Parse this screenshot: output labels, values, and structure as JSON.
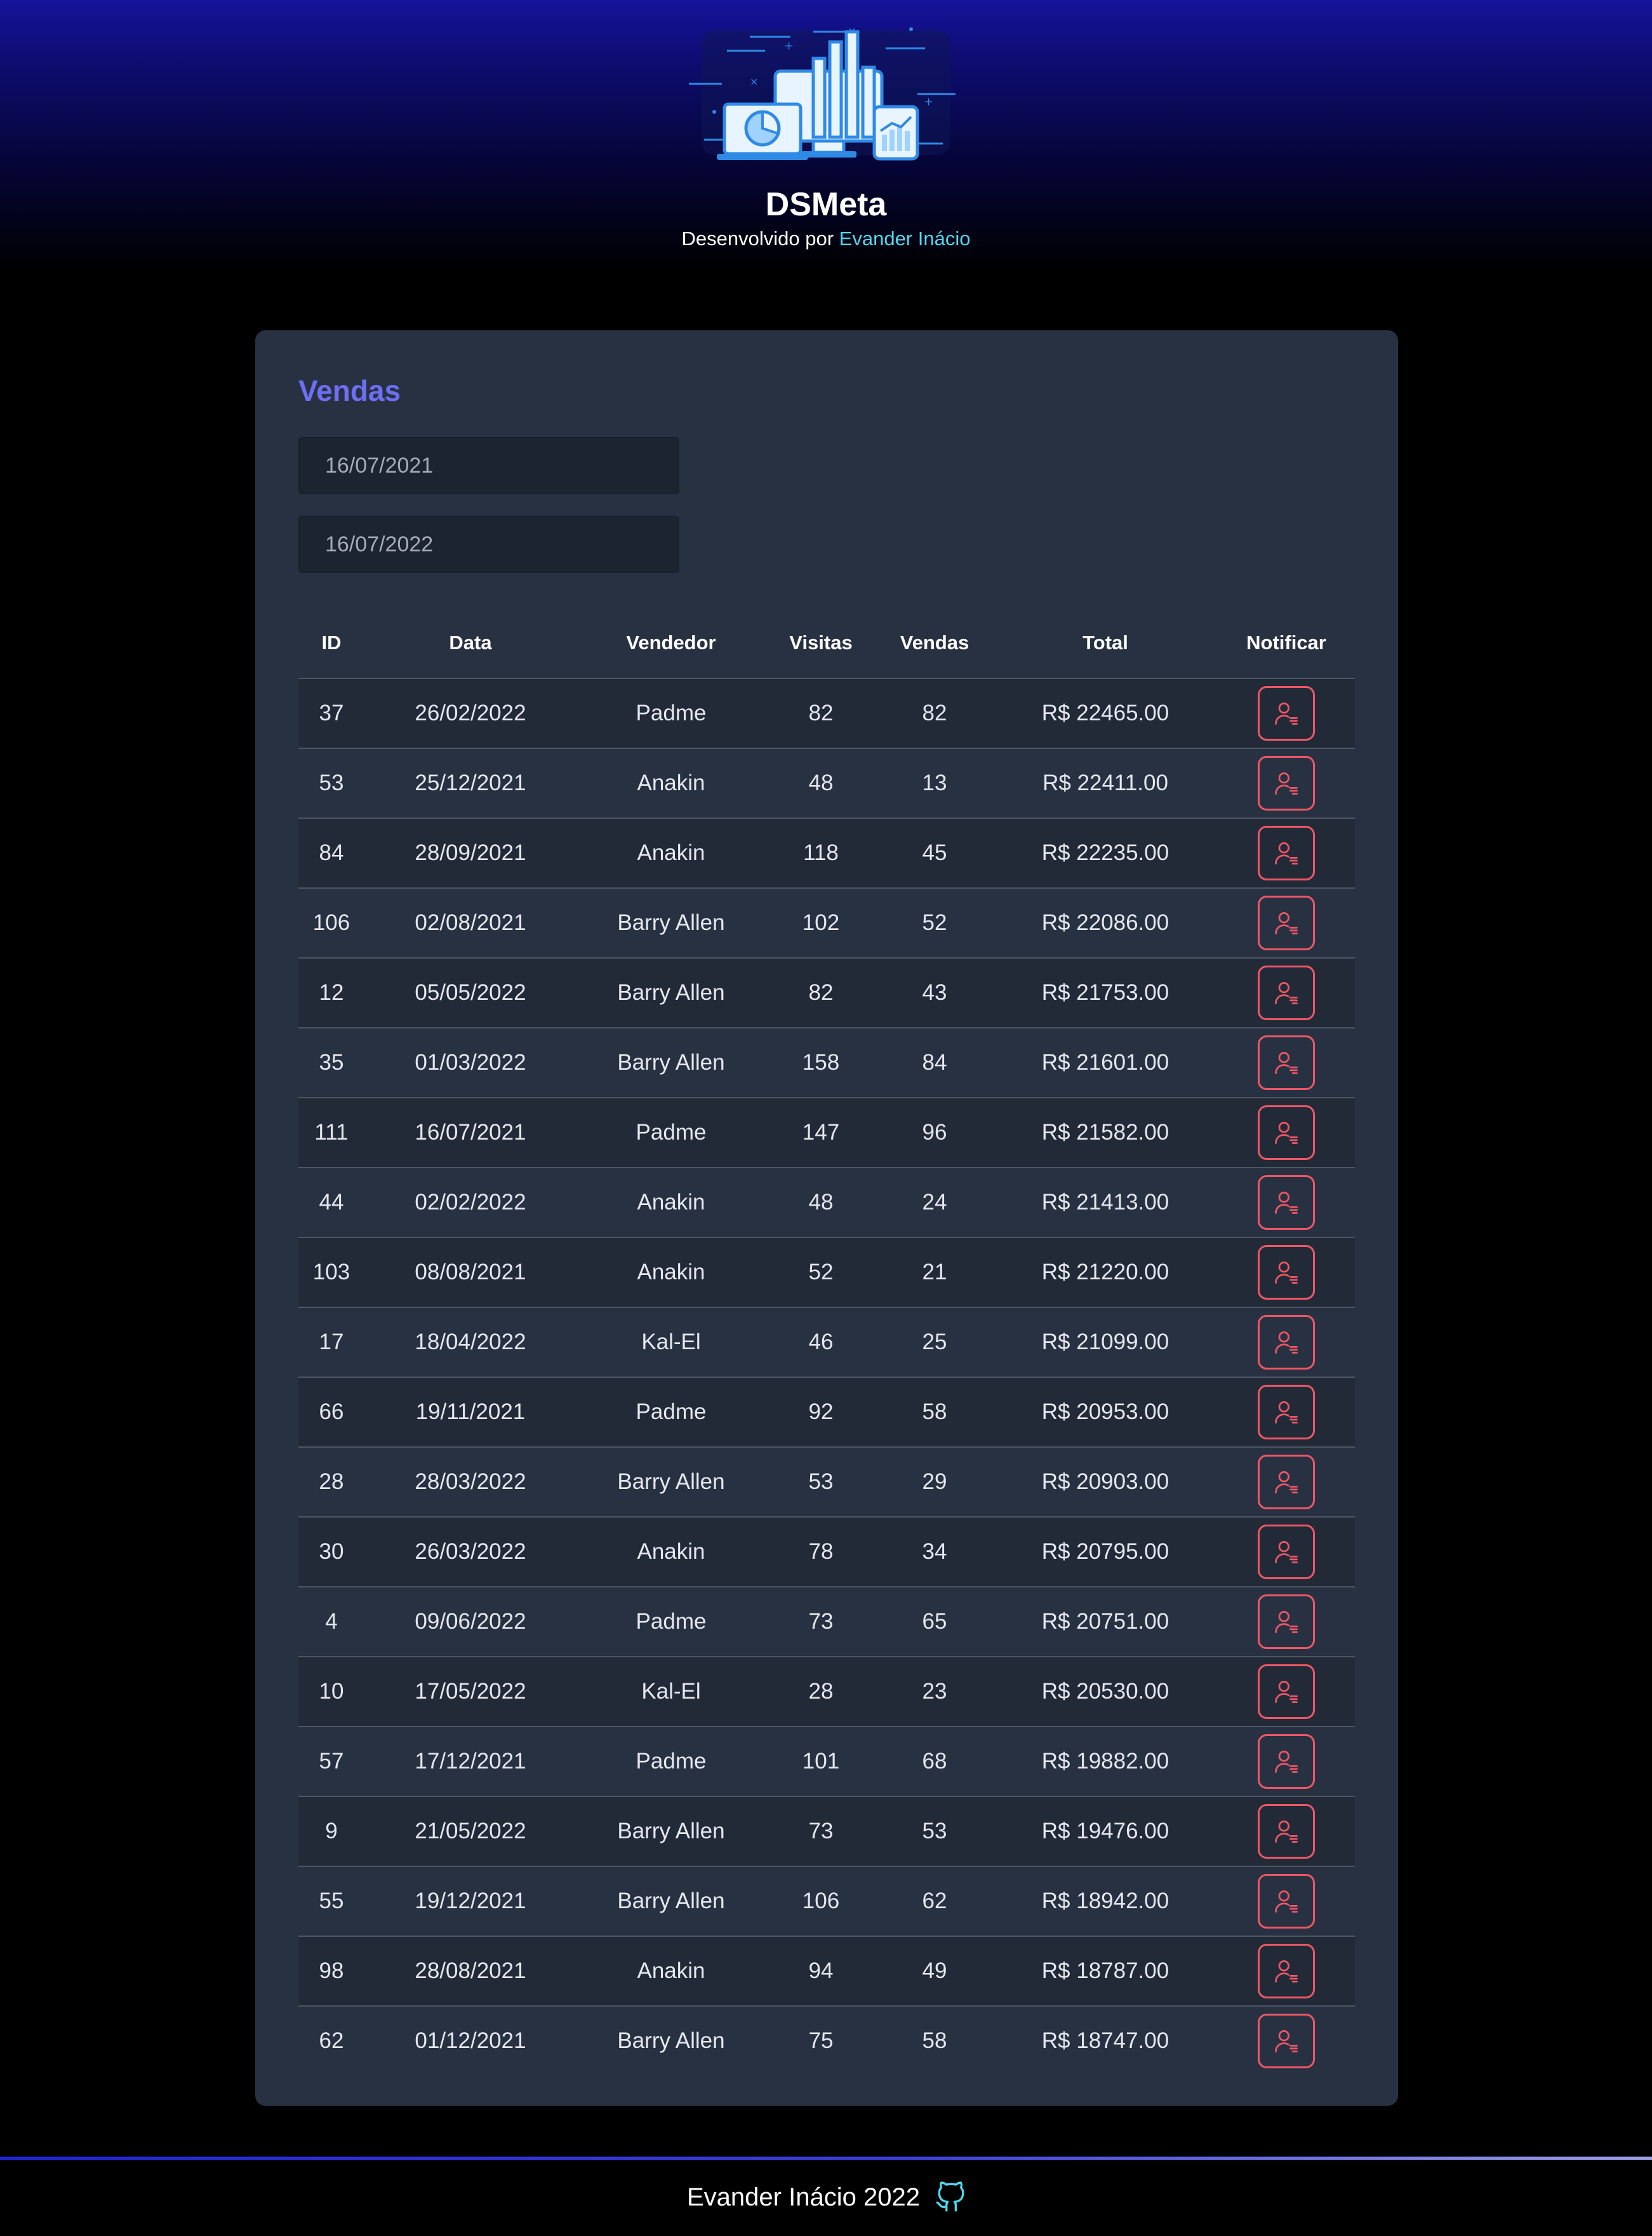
{
  "header": {
    "app_title": "DSMeta",
    "subtitle_prefix": "Desenvolvido por",
    "author_name": "Evander Inácio"
  },
  "sales": {
    "title": "Vendas",
    "date_start": "16/07/2021",
    "date_end": "16/07/2022",
    "columns": [
      "ID",
      "Data",
      "Vendedor",
      "Visitas",
      "Vendas",
      "Total",
      "Notificar"
    ],
    "rows": [
      {
        "id": "37",
        "date": "26/02/2022",
        "seller": "Padme",
        "visits": "82",
        "deals": "82",
        "total": "R$ 22465.00"
      },
      {
        "id": "53",
        "date": "25/12/2021",
        "seller": "Anakin",
        "visits": "48",
        "deals": "13",
        "total": "R$ 22411.00"
      },
      {
        "id": "84",
        "date": "28/09/2021",
        "seller": "Anakin",
        "visits": "118",
        "deals": "45",
        "total": "R$ 22235.00"
      },
      {
        "id": "106",
        "date": "02/08/2021",
        "seller": "Barry Allen",
        "visits": "102",
        "deals": "52",
        "total": "R$ 22086.00"
      },
      {
        "id": "12",
        "date": "05/05/2022",
        "seller": "Barry Allen",
        "visits": "82",
        "deals": "43",
        "total": "R$ 21753.00"
      },
      {
        "id": "35",
        "date": "01/03/2022",
        "seller": "Barry Allen",
        "visits": "158",
        "deals": "84",
        "total": "R$ 21601.00"
      },
      {
        "id": "111",
        "date": "16/07/2021",
        "seller": "Padme",
        "visits": "147",
        "deals": "96",
        "total": "R$ 21582.00"
      },
      {
        "id": "44",
        "date": "02/02/2022",
        "seller": "Anakin",
        "visits": "48",
        "deals": "24",
        "total": "R$ 21413.00"
      },
      {
        "id": "103",
        "date": "08/08/2021",
        "seller": "Anakin",
        "visits": "52",
        "deals": "21",
        "total": "R$ 21220.00"
      },
      {
        "id": "17",
        "date": "18/04/2022",
        "seller": "Kal-El",
        "visits": "46",
        "deals": "25",
        "total": "R$ 21099.00"
      },
      {
        "id": "66",
        "date": "19/11/2021",
        "seller": "Padme",
        "visits": "92",
        "deals": "58",
        "total": "R$ 20953.00"
      },
      {
        "id": "28",
        "date": "28/03/2022",
        "seller": "Barry Allen",
        "visits": "53",
        "deals": "29",
        "total": "R$ 20903.00"
      },
      {
        "id": "30",
        "date": "26/03/2022",
        "seller": "Anakin",
        "visits": "78",
        "deals": "34",
        "total": "R$ 20795.00"
      },
      {
        "id": "4",
        "date": "09/06/2022",
        "seller": "Padme",
        "visits": "73",
        "deals": "65",
        "total": "R$ 20751.00"
      },
      {
        "id": "10",
        "date": "17/05/2022",
        "seller": "Kal-El",
        "visits": "28",
        "deals": "23",
        "total": "R$ 20530.00"
      },
      {
        "id": "57",
        "date": "17/12/2021",
        "seller": "Padme",
        "visits": "101",
        "deals": "68",
        "total": "R$ 19882.00"
      },
      {
        "id": "9",
        "date": "21/05/2022",
        "seller": "Barry Allen",
        "visits": "73",
        "deals": "53",
        "total": "R$ 19476.00"
      },
      {
        "id": "55",
        "date": "19/12/2021",
        "seller": "Barry Allen",
        "visits": "106",
        "deals": "62",
        "total": "R$ 18942.00"
      },
      {
        "id": "98",
        "date": "28/08/2021",
        "seller": "Anakin",
        "visits": "94",
        "deals": "49",
        "total": "R$ 18787.00"
      },
      {
        "id": "62",
        "date": "01/12/2021",
        "seller": "Barry Allen",
        "visits": "75",
        "deals": "58",
        "total": "R$ 18747.00"
      }
    ]
  },
  "footer": {
    "text": "Evander Inácio 2022",
    "icon": "github-icon"
  },
  "icons": {
    "notify": "user-notify-icon",
    "logo": "dashboard-devices-illustration"
  },
  "colors": {
    "accent": "#6e6ff3",
    "link": "#4fd8ee",
    "notify_button": "#ef5766",
    "card_background": "#283142",
    "header_gradient_top": "#15139a"
  }
}
